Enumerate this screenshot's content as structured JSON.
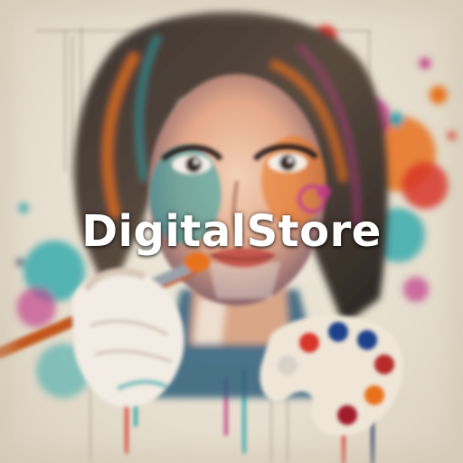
{
  "brand": {
    "title": "DigitalStore"
  },
  "artwork": {
    "icon": "painted-portrait-illustration",
    "palette": [
      "#e8721c",
      "#1fa3a8",
      "#c23a8a",
      "#d8362b",
      "#2d3a6b",
      "#f0b43a"
    ]
  }
}
